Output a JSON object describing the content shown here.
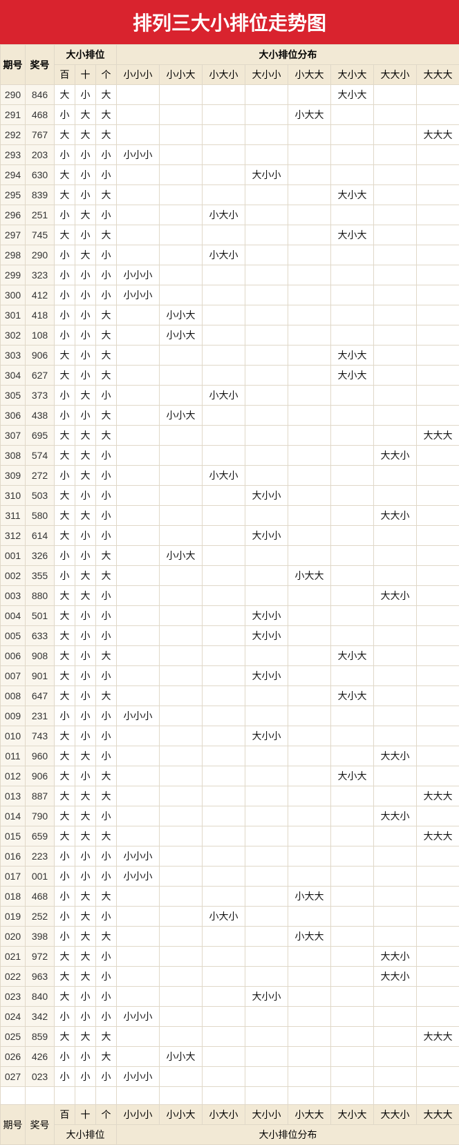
{
  "title": "排列三大小排位走势图",
  "headers": {
    "period": "期号",
    "award": "奖号",
    "pos_group": "大小排位",
    "dist_group": "大小排位分布",
    "pos_cols": [
      "百",
      "十",
      "个"
    ],
    "dist_cols": [
      "小小小",
      "小小大",
      "小大小",
      "大小小",
      "小大大",
      "大小大",
      "大大小",
      "大大大"
    ]
  },
  "chart_data": {
    "type": "table",
    "title": "排列三大小排位走势图",
    "rows": [
      {
        "period": "290",
        "award": "846",
        "pos": [
          "大",
          "小",
          "大"
        ],
        "dist_idx": 5
      },
      {
        "period": "291",
        "award": "468",
        "pos": [
          "小",
          "大",
          "大"
        ],
        "dist_idx": 4
      },
      {
        "period": "292",
        "award": "767",
        "pos": [
          "大",
          "大",
          "大"
        ],
        "dist_idx": 7
      },
      {
        "period": "293",
        "award": "203",
        "pos": [
          "小",
          "小",
          "小"
        ],
        "dist_idx": 0
      },
      {
        "period": "294",
        "award": "630",
        "pos": [
          "大",
          "小",
          "小"
        ],
        "dist_idx": 3
      },
      {
        "period": "295",
        "award": "839",
        "pos": [
          "大",
          "小",
          "大"
        ],
        "dist_idx": 5
      },
      {
        "period": "296",
        "award": "251",
        "pos": [
          "小",
          "大",
          "小"
        ],
        "dist_idx": 2
      },
      {
        "period": "297",
        "award": "745",
        "pos": [
          "大",
          "小",
          "大"
        ],
        "dist_idx": 5
      },
      {
        "period": "298",
        "award": "290",
        "pos": [
          "小",
          "大",
          "小"
        ],
        "dist_idx": 2
      },
      {
        "period": "299",
        "award": "323",
        "pos": [
          "小",
          "小",
          "小"
        ],
        "dist_idx": 0
      },
      {
        "period": "300",
        "award": "412",
        "pos": [
          "小",
          "小",
          "小"
        ],
        "dist_idx": 0
      },
      {
        "period": "301",
        "award": "418",
        "pos": [
          "小",
          "小",
          "大"
        ],
        "dist_idx": 1
      },
      {
        "period": "302",
        "award": "108",
        "pos": [
          "小",
          "小",
          "大"
        ],
        "dist_idx": 1
      },
      {
        "period": "303",
        "award": "906",
        "pos": [
          "大",
          "小",
          "大"
        ],
        "dist_idx": 5
      },
      {
        "period": "304",
        "award": "627",
        "pos": [
          "大",
          "小",
          "大"
        ],
        "dist_idx": 5
      },
      {
        "period": "305",
        "award": "373",
        "pos": [
          "小",
          "大",
          "小"
        ],
        "dist_idx": 2
      },
      {
        "period": "306",
        "award": "438",
        "pos": [
          "小",
          "小",
          "大"
        ],
        "dist_idx": 1
      },
      {
        "period": "307",
        "award": "695",
        "pos": [
          "大",
          "大",
          "大"
        ],
        "dist_idx": 7
      },
      {
        "period": "308",
        "award": "574",
        "pos": [
          "大",
          "大",
          "小"
        ],
        "dist_idx": 6
      },
      {
        "period": "309",
        "award": "272",
        "pos": [
          "小",
          "大",
          "小"
        ],
        "dist_idx": 2
      },
      {
        "period": "310",
        "award": "503",
        "pos": [
          "大",
          "小",
          "小"
        ],
        "dist_idx": 3
      },
      {
        "period": "311",
        "award": "580",
        "pos": [
          "大",
          "大",
          "小"
        ],
        "dist_idx": 6
      },
      {
        "period": "312",
        "award": "614",
        "pos": [
          "大",
          "小",
          "小"
        ],
        "dist_idx": 3
      },
      {
        "period": "001",
        "award": "326",
        "pos": [
          "小",
          "小",
          "大"
        ],
        "dist_idx": 1
      },
      {
        "period": "002",
        "award": "355",
        "pos": [
          "小",
          "大",
          "大"
        ],
        "dist_idx": 4
      },
      {
        "period": "003",
        "award": "880",
        "pos": [
          "大",
          "大",
          "小"
        ],
        "dist_idx": 6
      },
      {
        "period": "004",
        "award": "501",
        "pos": [
          "大",
          "小",
          "小"
        ],
        "dist_idx": 3
      },
      {
        "period": "005",
        "award": "633",
        "pos": [
          "大",
          "小",
          "小"
        ],
        "dist_idx": 3
      },
      {
        "period": "006",
        "award": "908",
        "pos": [
          "大",
          "小",
          "大"
        ],
        "dist_idx": 5
      },
      {
        "period": "007",
        "award": "901",
        "pos": [
          "大",
          "小",
          "小"
        ],
        "dist_idx": 3
      },
      {
        "period": "008",
        "award": "647",
        "pos": [
          "大",
          "小",
          "大"
        ],
        "dist_idx": 5
      },
      {
        "period": "009",
        "award": "231",
        "pos": [
          "小",
          "小",
          "小"
        ],
        "dist_idx": 0
      },
      {
        "period": "010",
        "award": "743",
        "pos": [
          "大",
          "小",
          "小"
        ],
        "dist_idx": 3
      },
      {
        "period": "011",
        "award": "960",
        "pos": [
          "大",
          "大",
          "小"
        ],
        "dist_idx": 6
      },
      {
        "period": "012",
        "award": "906",
        "pos": [
          "大",
          "小",
          "大"
        ],
        "dist_idx": 5
      },
      {
        "period": "013",
        "award": "887",
        "pos": [
          "大",
          "大",
          "大"
        ],
        "dist_idx": 7
      },
      {
        "period": "014",
        "award": "790",
        "pos": [
          "大",
          "大",
          "小"
        ],
        "dist_idx": 6
      },
      {
        "period": "015",
        "award": "659",
        "pos": [
          "大",
          "大",
          "大"
        ],
        "dist_idx": 7
      },
      {
        "period": "016",
        "award": "223",
        "pos": [
          "小",
          "小",
          "小"
        ],
        "dist_idx": 0
      },
      {
        "period": "017",
        "award": "001",
        "pos": [
          "小",
          "小",
          "小"
        ],
        "dist_idx": 0
      },
      {
        "period": "018",
        "award": "468",
        "pos": [
          "小",
          "大",
          "大"
        ],
        "dist_idx": 4
      },
      {
        "period": "019",
        "award": "252",
        "pos": [
          "小",
          "大",
          "小"
        ],
        "dist_idx": 2
      },
      {
        "period": "020",
        "award": "398",
        "pos": [
          "小",
          "大",
          "大"
        ],
        "dist_idx": 4
      },
      {
        "period": "021",
        "award": "972",
        "pos": [
          "大",
          "大",
          "小"
        ],
        "dist_idx": 6
      },
      {
        "period": "022",
        "award": "963",
        "pos": [
          "大",
          "大",
          "小"
        ],
        "dist_idx": 6
      },
      {
        "period": "023",
        "award": "840",
        "pos": [
          "大",
          "小",
          "小"
        ],
        "dist_idx": 3
      },
      {
        "period": "024",
        "award": "342",
        "pos": [
          "小",
          "小",
          "小"
        ],
        "dist_idx": 0
      },
      {
        "period": "025",
        "award": "859",
        "pos": [
          "大",
          "大",
          "大"
        ],
        "dist_idx": 7
      },
      {
        "period": "026",
        "award": "426",
        "pos": [
          "小",
          "小",
          "大"
        ],
        "dist_idx": 1
      },
      {
        "period": "027",
        "award": "023",
        "pos": [
          "小",
          "小",
          "小"
        ],
        "dist_idx": 0
      }
    ]
  }
}
